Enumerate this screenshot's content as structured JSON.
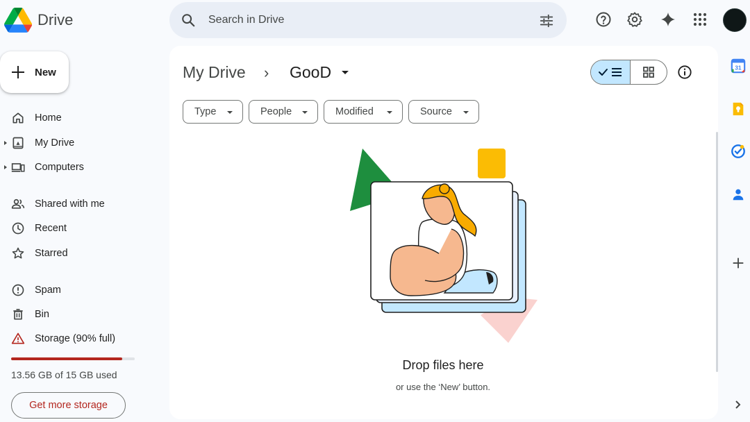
{
  "header": {
    "brand": "Drive",
    "search_placeholder": "Search in Drive",
    "icons": [
      "drive-logo",
      "search-icon",
      "tune-icon",
      "help-icon",
      "settings-icon",
      "gemini-icon",
      "apps-icon",
      "avatar"
    ]
  },
  "sidebar": {
    "new_label": "New",
    "items": [
      {
        "label": "Home",
        "icon": "home-icon"
      },
      {
        "label": "My Drive",
        "icon": "my-drive-icon"
      },
      {
        "label": "Computers",
        "icon": "computers-icon"
      },
      {
        "label": "Shared with me",
        "icon": "shared-icon"
      },
      {
        "label": "Recent",
        "icon": "clock-icon"
      },
      {
        "label": "Starred",
        "icon": "star-icon"
      },
      {
        "label": "Spam",
        "icon": "spam-icon"
      },
      {
        "label": "Bin",
        "icon": "bin-icon"
      },
      {
        "label": "Storage (90% full)",
        "icon": "warning-icon"
      }
    ],
    "storage_used_fraction": 0.9,
    "storage_text": "13.56 GB of 15 GB used",
    "get_storage_label": "Get more storage"
  },
  "main": {
    "breadcrumb": {
      "root": "My Drive",
      "separator": "›",
      "current": "GooD"
    },
    "filters": [
      "Type",
      "People",
      "Modified",
      "Source"
    ],
    "empty_title": "Drop files here",
    "empty_subtitle": "or use the ‘New’ button."
  },
  "side_panel": {
    "apps": [
      "calendar-icon",
      "keep-icon",
      "tasks-icon",
      "contacts-icon",
      "add-icon",
      "expand-icon"
    ]
  },
  "colors": {
    "background": "#f8fafd",
    "search_bg": "#e9eef6",
    "toggle_active": "#c2e7ff",
    "storage_warning": "#b3261e"
  }
}
